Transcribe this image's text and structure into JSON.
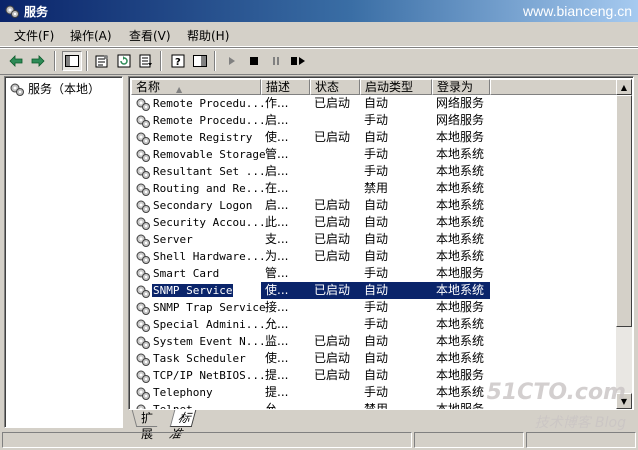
{
  "window": {
    "title": "服务",
    "watermark": "www.bianceng.cn"
  },
  "menu": [
    {
      "label": "文件(F)"
    },
    {
      "label": "操作(A)"
    },
    {
      "label": "查看(V)"
    },
    {
      "label": "帮助(H)"
    }
  ],
  "tree": {
    "root": "服务（本地）"
  },
  "columns": [
    {
      "label": "名称"
    },
    {
      "label": "描述"
    },
    {
      "label": "状态"
    },
    {
      "label": "启动类型"
    },
    {
      "label": "登录为"
    }
  ],
  "rows": [
    {
      "name": "Remote Procedu...",
      "desc": "作...",
      "status": "已启动",
      "startup": "自动",
      "logon": "网络服务"
    },
    {
      "name": "Remote Procedu...",
      "desc": "启...",
      "status": "",
      "startup": "手动",
      "logon": "网络服务"
    },
    {
      "name": "Remote Registry",
      "desc": "使...",
      "status": "已启动",
      "startup": "自动",
      "logon": "本地服务"
    },
    {
      "name": "Removable Storage",
      "desc": "管...",
      "status": "",
      "startup": "手动",
      "logon": "本地系统"
    },
    {
      "name": "Resultant Set ...",
      "desc": "启...",
      "status": "",
      "startup": "手动",
      "logon": "本地系统"
    },
    {
      "name": "Routing and Re...",
      "desc": "在...",
      "status": "",
      "startup": "禁用",
      "logon": "本地系统"
    },
    {
      "name": "Secondary Logon",
      "desc": "启...",
      "status": "已启动",
      "startup": "自动",
      "logon": "本地系统"
    },
    {
      "name": "Security Accou...",
      "desc": "此...",
      "status": "已启动",
      "startup": "自动",
      "logon": "本地系统"
    },
    {
      "name": "Server",
      "desc": "支...",
      "status": "已启动",
      "startup": "自动",
      "logon": "本地系统"
    },
    {
      "name": "Shell Hardware...",
      "desc": "为...",
      "status": "已启动",
      "startup": "自动",
      "logon": "本地系统"
    },
    {
      "name": "Smart Card",
      "desc": "管...",
      "status": "",
      "startup": "手动",
      "logon": "本地服务"
    },
    {
      "name": "SNMP Service",
      "desc": "使...",
      "status": "已启动",
      "startup": "自动",
      "logon": "本地系统",
      "selected": true
    },
    {
      "name": "SNMP Trap Service",
      "desc": "接...",
      "status": "",
      "startup": "手动",
      "logon": "本地服务"
    },
    {
      "name": "Special Admini...",
      "desc": "允...",
      "status": "",
      "startup": "手动",
      "logon": "本地系统"
    },
    {
      "name": "System Event N...",
      "desc": "监...",
      "status": "已启动",
      "startup": "自动",
      "logon": "本地系统"
    },
    {
      "name": "Task Scheduler",
      "desc": "使...",
      "status": "已启动",
      "startup": "自动",
      "logon": "本地系统"
    },
    {
      "name": "TCP/IP NetBIOS...",
      "desc": "提...",
      "status": "已启动",
      "startup": "自动",
      "logon": "本地服务"
    },
    {
      "name": "Telephony",
      "desc": "提...",
      "status": "",
      "startup": "手动",
      "logon": "本地系统"
    },
    {
      "name": "Telnet",
      "desc": "允...",
      "status": "",
      "startup": "禁用",
      "logon": "本地服务"
    }
  ],
  "tabs": [
    {
      "label": "扩展"
    },
    {
      "label": "标准"
    }
  ],
  "watermarks": {
    "site": "51CTO.com",
    "sub": "技术博客 Blog"
  },
  "colors": {
    "title_start": "#0a246a",
    "title_end": "#a6caf0",
    "selection": "#0a246a"
  }
}
